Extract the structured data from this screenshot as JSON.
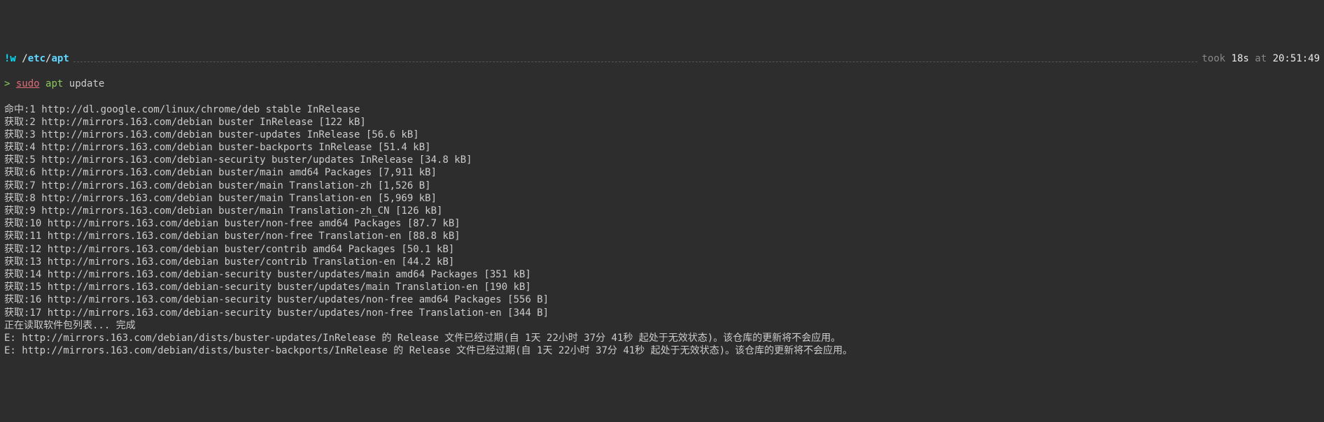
{
  "header": {
    "bang": "!w",
    "slash1": "/",
    "seg_etc": "etc",
    "slash2": "/",
    "seg_apt": "apt",
    "took_label": "took",
    "took_value": "18s",
    "at_label": "at",
    "time": "20:51:49"
  },
  "prompt": {
    "symbol": ">",
    "sudo": "sudo",
    "apt": "apt",
    "cmd": "update"
  },
  "lines": [
    "命中:1 http://dl.google.com/linux/chrome/deb stable InRelease",
    "获取:2 http://mirrors.163.com/debian buster InRelease [122 kB]",
    "获取:3 http://mirrors.163.com/debian buster-updates InRelease [56.6 kB]",
    "获取:4 http://mirrors.163.com/debian buster-backports InRelease [51.4 kB]",
    "获取:5 http://mirrors.163.com/debian-security buster/updates InRelease [34.8 kB]",
    "获取:6 http://mirrors.163.com/debian buster/main amd64 Packages [7,911 kB]",
    "获取:7 http://mirrors.163.com/debian buster/main Translation-zh [1,526 B]",
    "获取:8 http://mirrors.163.com/debian buster/main Translation-en [5,969 kB]",
    "获取:9 http://mirrors.163.com/debian buster/main Translation-zh_CN [126 kB]",
    "获取:10 http://mirrors.163.com/debian buster/non-free amd64 Packages [87.7 kB]",
    "获取:11 http://mirrors.163.com/debian buster/non-free Translation-en [88.8 kB]",
    "获取:12 http://mirrors.163.com/debian buster/contrib amd64 Packages [50.1 kB]",
    "获取:13 http://mirrors.163.com/debian buster/contrib Translation-en [44.2 kB]",
    "获取:14 http://mirrors.163.com/debian-security buster/updates/main amd64 Packages [351 kB]",
    "获取:15 http://mirrors.163.com/debian-security buster/updates/main Translation-en [190 kB]",
    "获取:16 http://mirrors.163.com/debian-security buster/updates/non-free amd64 Packages [556 B]",
    "获取:17 http://mirrors.163.com/debian-security buster/updates/non-free Translation-en [344 B]",
    "正在读取软件包列表... 完成",
    "E: http://mirrors.163.com/debian/dists/buster-updates/InRelease 的 Release 文件已经过期(自 1天 22小时 37分 41秒 起处于无效状态)。该仓库的更新将不会应用。",
    "E: http://mirrors.163.com/debian/dists/buster-backports/InRelease 的 Release 文件已经过期(自 1天 22小时 37分 41秒 起处于无效状态)。该仓库的更新将不会应用。"
  ]
}
